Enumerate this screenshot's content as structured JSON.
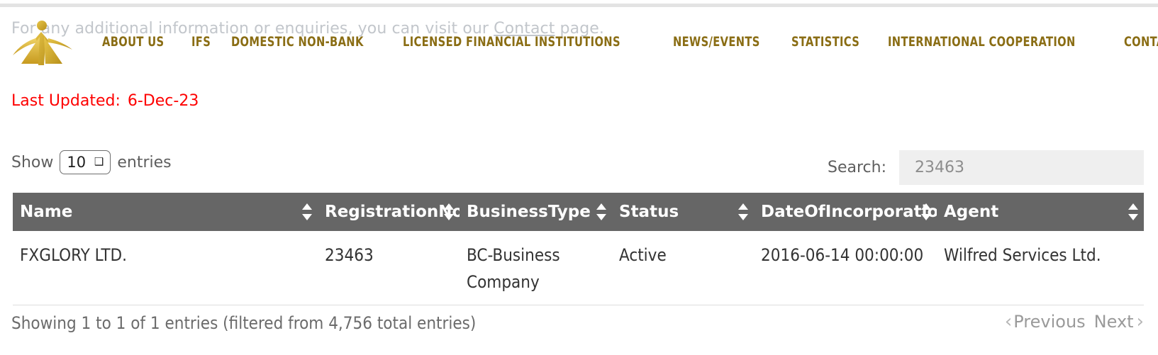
{
  "banner": {
    "text_before": "For any additional information or enquiries, you can visit our ",
    "link_text": "Contact",
    "text_after": " page."
  },
  "logo": {
    "name": "fsc-logo"
  },
  "nav": {
    "items": [
      {
        "label": "ABOUT US"
      },
      {
        "label": "IFS"
      },
      {
        "label": "DOMESTIC NON-BANK"
      },
      {
        "label": "LICENSED FINANCIAL INSTITUTIONS"
      },
      {
        "label": "NEWS/EVENTS"
      },
      {
        "label": "STATISTICS"
      },
      {
        "label": "INTERNATIONAL COOPERATION"
      },
      {
        "label": "CONTACT US"
      }
    ]
  },
  "last_updated": {
    "label": "Last Updated:",
    "date": "6-Dec-23",
    "color": "#fe0000"
  },
  "length_control": {
    "label_before": "Show",
    "value": "10",
    "label_after": "entries",
    "caret": "chevron-down-icon"
  },
  "search": {
    "label": "Search:",
    "value": "23463",
    "placeholder": ""
  },
  "table": {
    "columns": [
      {
        "label": "Name"
      },
      {
        "label": "RegistrationNo"
      },
      {
        "label": "BusinessType"
      },
      {
        "label": "Status"
      },
      {
        "label": "DateOfIncorporation"
      },
      {
        "label": "Agent"
      }
    ],
    "rows": [
      {
        "name": "FXGLORY LTD.",
        "registration_no": "23463",
        "business_type": "BC-Business Company",
        "status": "Active",
        "date_of_incorporation": "2016-06-14 00:00:00",
        "agent": "Wilfred Services Ltd."
      }
    ],
    "header_bg": "#666666"
  },
  "footer": {
    "info": "Showing 1 to 1 of 1 entries (filtered from 4,756 total entries)",
    "previous_label": "Previous",
    "next_label": "Next",
    "chevron_left": "‹",
    "chevron_right": "›"
  }
}
